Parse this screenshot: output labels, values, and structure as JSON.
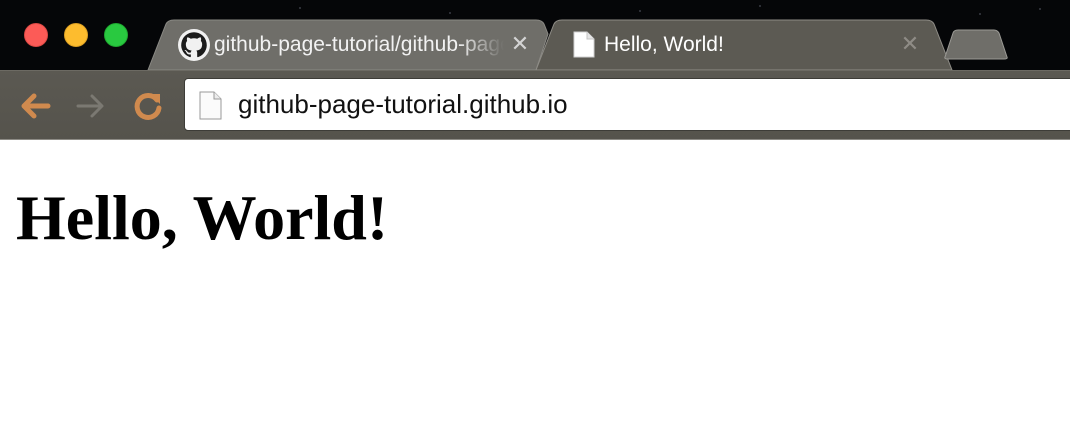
{
  "window": {
    "controls": [
      "close",
      "minimize",
      "maximize"
    ]
  },
  "tabs": [
    {
      "title": "github-page-tutorial/github-page-tutorial.github.io",
      "icon": "github-icon",
      "active": false
    },
    {
      "title": "Hello, World!",
      "icon": "document-icon",
      "active": true
    }
  ],
  "tab_close_glyph": "✕",
  "toolbar": {
    "back_icon": "back-arrow-icon",
    "forward_icon": "forward-arrow-icon",
    "reload_icon": "reload-icon"
  },
  "omnibox": {
    "url": "github-page-tutorial.github.io",
    "icon": "page-icon"
  },
  "page": {
    "heading": "Hello, World!"
  },
  "colors": {
    "close": "#fc5b57",
    "minimize": "#fdbc2e",
    "maximize": "#29c940",
    "nav_accent": "#d08a4e",
    "toolbar": "#58564f",
    "tabstrip": "#050608"
  }
}
